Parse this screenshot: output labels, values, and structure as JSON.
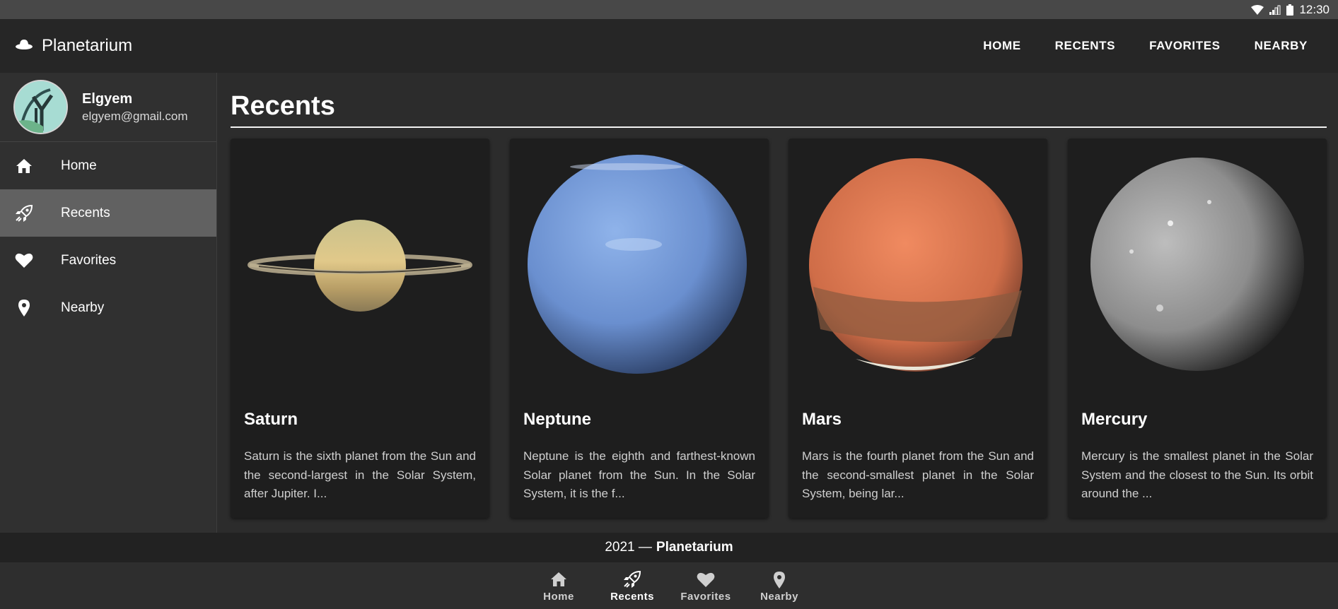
{
  "status_bar": {
    "time": "12:30",
    "icons": [
      "wifi-icon",
      "signal-icon",
      "battery-icon"
    ]
  },
  "app_bar": {
    "title": "Planetarium",
    "logo_icon": "ufo-icon",
    "nav": [
      {
        "label": "HOME"
      },
      {
        "label": "RECENTS"
      },
      {
        "label": "FAVORITES"
      },
      {
        "label": "NEARBY"
      }
    ]
  },
  "drawer": {
    "profile": {
      "name": "Elgyem",
      "email": "elgyem@gmail.com"
    },
    "items": [
      {
        "label": "Home",
        "icon": "home-icon",
        "active": false
      },
      {
        "label": "Recents",
        "icon": "rocket-icon",
        "active": true
      },
      {
        "label": "Favorites",
        "icon": "heart-icon",
        "active": false
      },
      {
        "label": "Nearby",
        "icon": "location-pin-icon",
        "active": false
      }
    ]
  },
  "main": {
    "title": "Recents",
    "cards": [
      {
        "name": "Saturn",
        "description": "Saturn is the sixth planet from the Sun and the second-largest in the Solar System, after Jupiter. I..."
      },
      {
        "name": "Neptune",
        "description": "Neptune is the eighth and farthest-known Solar planet from the Sun. In the Solar System, it is the f..."
      },
      {
        "name": "Mars",
        "description": "Mars is the fourth planet from the Sun and the second-smallest planet in the Solar System, being lar..."
      },
      {
        "name": "Mercury",
        "description": "Mercury is the smallest planet in the Solar System and the closest to the Sun. Its orbit around the ..."
      }
    ]
  },
  "footer": {
    "year": "2021 —",
    "brand": "Planetarium"
  },
  "bottom_nav": {
    "items": [
      {
        "label": "Home",
        "icon": "home-icon",
        "active": false
      },
      {
        "label": "Recents",
        "icon": "rocket-icon",
        "active": true
      },
      {
        "label": "Favorites",
        "icon": "heart-icon",
        "active": false
      },
      {
        "label": "Nearby",
        "icon": "location-pin-icon",
        "active": false
      }
    ]
  },
  "colors": {
    "app_bar_bg": "#262626",
    "drawer_bg": "#303030",
    "active_item_bg": "#616161",
    "card_bg": "#1e1e1e"
  }
}
